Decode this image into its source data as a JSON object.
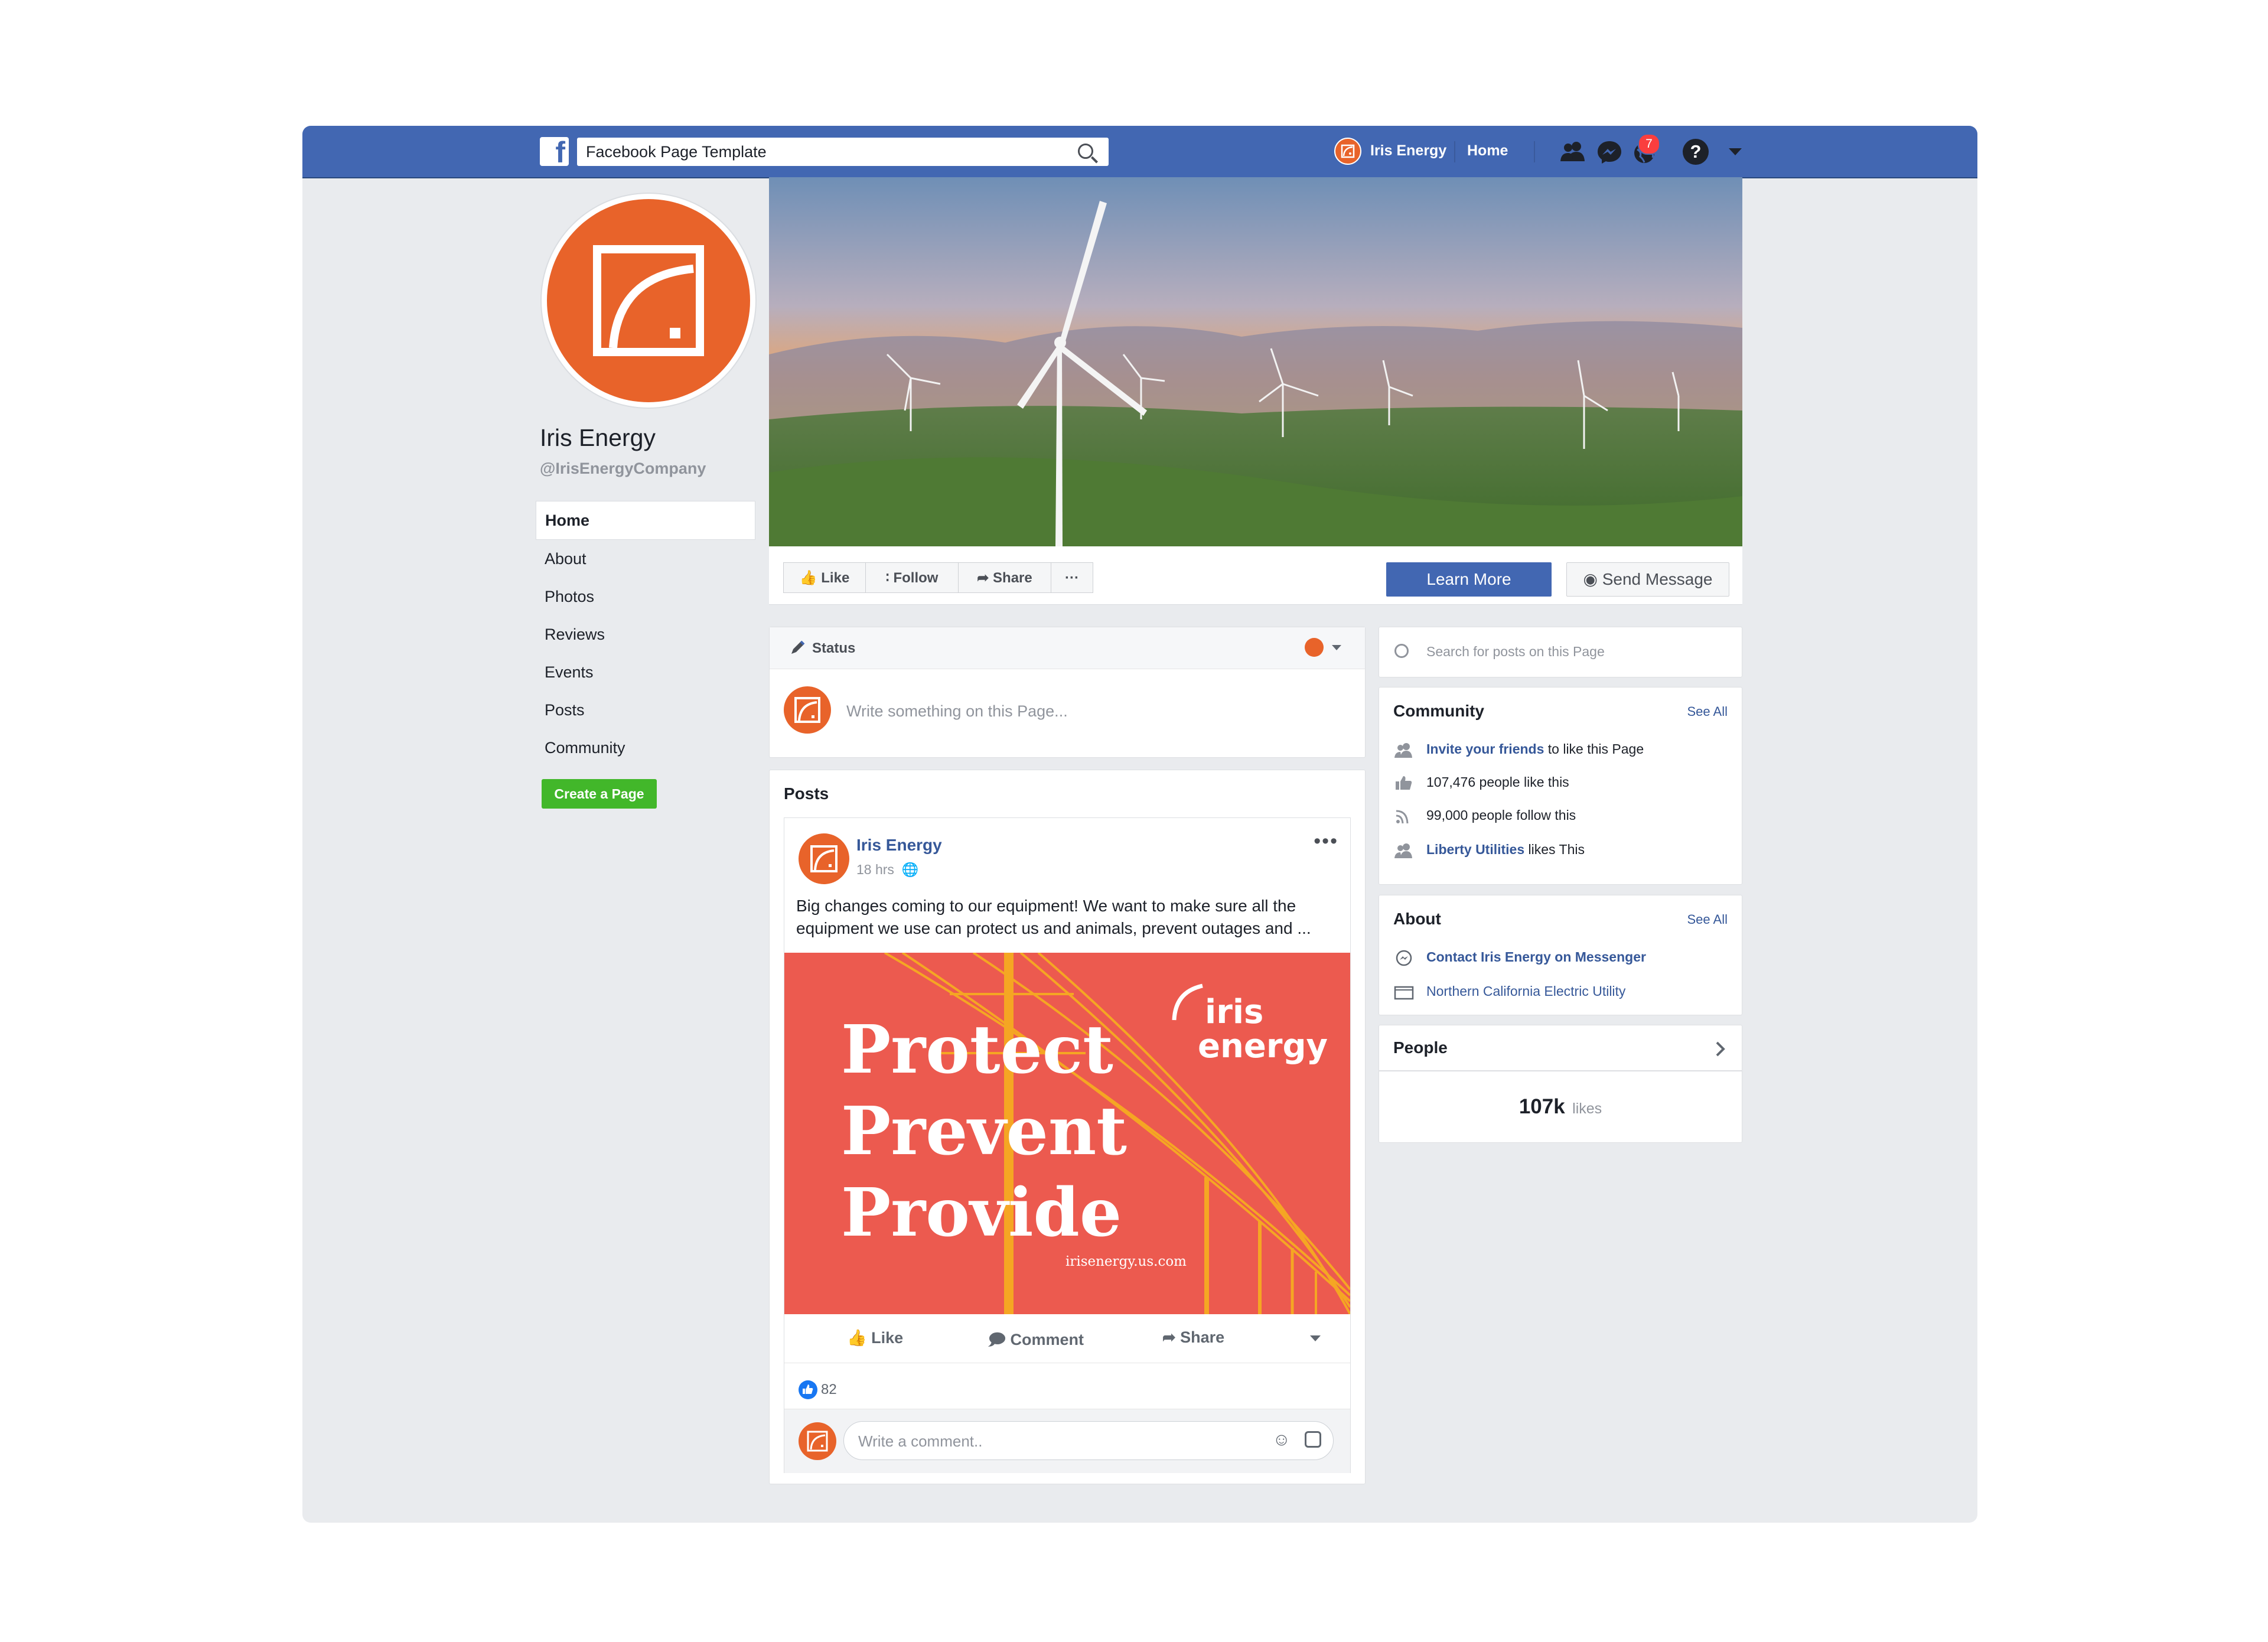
{
  "topbar": {
    "search_value": "Facebook Page Template",
    "page_name": "Iris Energy",
    "home_label": "Home",
    "notifications_count": "7"
  },
  "profile": {
    "name": "Iris Energy",
    "handle": "@IrisEnergyCompany"
  },
  "nav": {
    "items": [
      "Home",
      "About",
      "Photos",
      "Reviews",
      "Events",
      "Posts",
      "Community"
    ],
    "create_page": "Create a Page"
  },
  "actions": {
    "like": "Like",
    "follow": "Follow",
    "share": "Share",
    "more": "···",
    "learn_more": "Learn More",
    "send_message": "Send Message"
  },
  "composer": {
    "status_label": "Status",
    "placeholder": "Write something on this Page..."
  },
  "posts": {
    "title": "Posts",
    "post": {
      "author": "Iris Energy",
      "time": "18 hrs",
      "text": "Big changes coming to our equipment! We want to make sure all the equipment we use can protect us and animals, prevent outages and ...",
      "image": {
        "line1": "Protect",
        "line2": "Prevent",
        "line3": "Provide",
        "brand1": "iris",
        "brand2": "energy",
        "url": "irisenergy.us.com"
      },
      "like_label": "Like",
      "comment_label": "Comment",
      "share_label": "Share",
      "likes_count": "82",
      "comment_placeholder": "Write a comment.."
    }
  },
  "sidebar": {
    "search_placeholder": "Search for posts on this Page",
    "community": {
      "title": "Community",
      "see_all": "See All",
      "invite_link": "Invite your friends",
      "invite_rest": " to like this Page",
      "likes": "107,476 people like this",
      "follows": "99,000 people follow this",
      "liked_by_link": "Liberty Utilities",
      "liked_by_rest": " likes This"
    },
    "about": {
      "title": "About",
      "see_all": "See All",
      "messenger": "Contact Iris Energy on Messenger",
      "category": "Northern California Electric Utility"
    },
    "people": {
      "title": "People",
      "count": "107k",
      "unit": "likes"
    }
  },
  "colors": {
    "facebook_blue": "#4267b2",
    "brand_orange": "#e8632a",
    "post_coral": "#ec5a4f",
    "create_green": "#42b72a"
  }
}
